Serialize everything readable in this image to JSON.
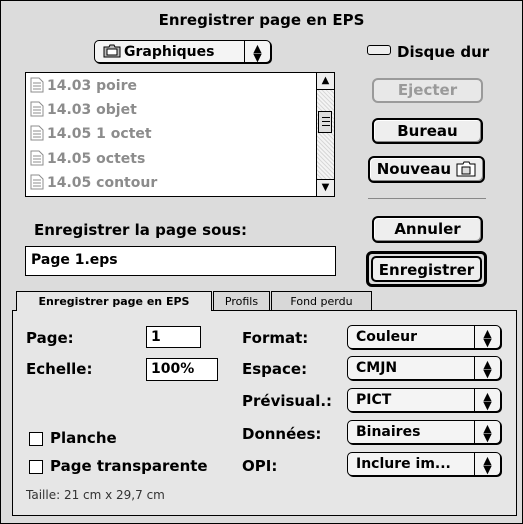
{
  "dialog": {
    "title": "Enregistrer page en EPS"
  },
  "folder_popup": {
    "label": "Graphiques",
    "icon": "folder-icon"
  },
  "disk": {
    "label": "Disque dur",
    "icon": "disk-icon"
  },
  "file_list": {
    "items": [
      {
        "label": "14.03 poire"
      },
      {
        "label": "14.03 objet"
      },
      {
        "label": "14.05 1 octet"
      },
      {
        "label": "14.05 octets"
      },
      {
        "label": "14.05 contour"
      }
    ]
  },
  "buttons": {
    "eject": "Ejecter",
    "desktop": "Bureau",
    "new": "Nouveau",
    "cancel": "Annuler",
    "save": "Enregistrer"
  },
  "save_as": {
    "label": "Enregistrer la page sous:",
    "value": "Page 1.eps"
  },
  "tabs": [
    {
      "label": "Enregistrer page en EPS",
      "active": true
    },
    {
      "label": "Profils",
      "active": false
    },
    {
      "label": "Fond perdu",
      "active": false
    }
  ],
  "options": {
    "page_label": "Page:",
    "page_value": "1",
    "scale_label": "Echelle:",
    "scale_value": "100%",
    "spread_label": "Planche",
    "transparent_label": "Page transparente",
    "size_text": "Taille:  21  cm x 29,7  cm",
    "format_label": "Format:",
    "format_value": "Couleur",
    "space_label": "Espace:",
    "space_value": "CMJN",
    "preview_label": "Prévisual.:",
    "preview_value": "PICT",
    "data_label": "Données:",
    "data_value": "Binaires",
    "opi_label": "OPI:",
    "opi_value": "Inclure im..."
  }
}
